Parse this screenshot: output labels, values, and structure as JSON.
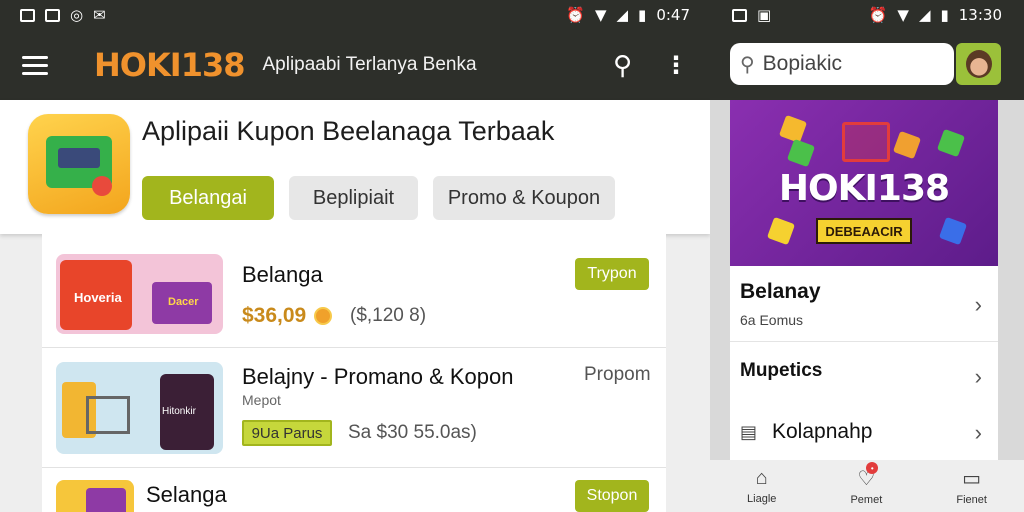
{
  "left": {
    "status": {
      "time": "0:47"
    },
    "appbar": {
      "brand": "HOKI138",
      "tagline": "Aplipaabi Terlanya Benka"
    },
    "hero": {
      "title": "Aplipaii Kupon Beelanaga Terbaak",
      "chips": [
        "Belangai",
        "Beplipiait",
        "Promo & Koupon"
      ]
    },
    "items": [
      {
        "title": "Belanga",
        "tag": "Trypon",
        "price": "$36,09",
        "old_price": "($,120 8)",
        "thumb_label": "Hoveria",
        "thumb_label2": "Dacer"
      },
      {
        "title": "Belajny - Promano & Kopon",
        "tag": "Propom",
        "sub": "Mepot",
        "promo": "9Ua Parus",
        "old_price": "Sa $30 55.0as)",
        "thumb_label": "Hitonkir"
      },
      {
        "title": "Selanga",
        "tag": "Stopon"
      }
    ]
  },
  "right": {
    "status": {
      "time": "13:30"
    },
    "search": {
      "placeholder": "Bopiakic"
    },
    "banner": {
      "title": "HOKI138",
      "cta": "DEBEAACIR"
    },
    "items": [
      {
        "title": "Belanay",
        "sub": "6a Eomus"
      },
      {
        "title": "Mupetics"
      },
      {
        "title": "Kolapnahp"
      }
    ],
    "nav": [
      "Liagle",
      "Pemet",
      "Fienet"
    ]
  }
}
